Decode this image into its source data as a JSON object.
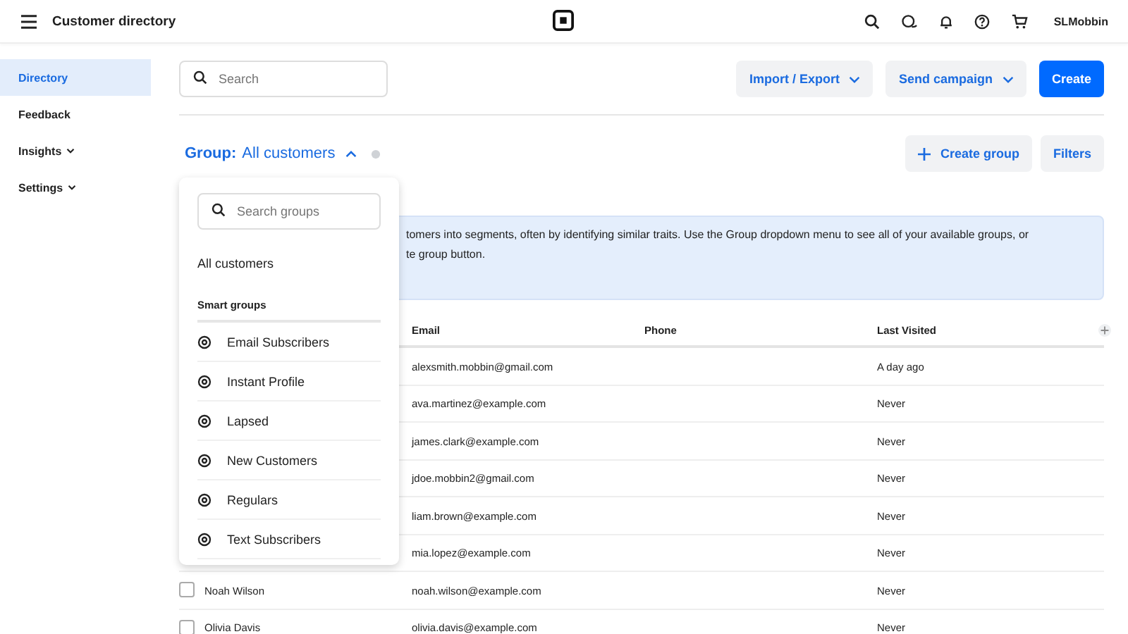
{
  "topbar": {
    "title": "Customer directory",
    "user": "SLMobbin"
  },
  "sidebar": {
    "items": [
      {
        "label": "Directory",
        "selected": true,
        "expandable": false
      },
      {
        "label": "Feedback",
        "selected": false,
        "expandable": false
      },
      {
        "label": "Insights",
        "selected": false,
        "expandable": true
      },
      {
        "label": "Settings",
        "selected": false,
        "expandable": true
      }
    ]
  },
  "search": {
    "placeholder": "Search"
  },
  "actions": [
    {
      "label": "Import / Export",
      "kind": "menu"
    },
    {
      "label": "Send campaign",
      "kind": "menu"
    },
    {
      "label": "Create",
      "kind": "primary"
    }
  ],
  "group": {
    "label": "Group:",
    "value": "All customers",
    "expanded": true
  },
  "group_actions": [
    {
      "label": "Create group",
      "kind": "add"
    },
    {
      "label": "Filters",
      "kind": "plain"
    }
  ],
  "banner": {
    "lines": [
      "tomers into segments, often by identifying similar traits. Use the Group dropdown menu to see all of your available groups, or",
      "te group button."
    ]
  },
  "table": {
    "columns": [
      "Email",
      "Phone",
      "Last Visited"
    ],
    "rows": [
      {
        "email": "alexsmith.mobbin@gmail.com",
        "last_visited": "A day ago"
      },
      {
        "email": "ava.martinez@example.com",
        "last_visited": "Never"
      },
      {
        "email": "james.clark@example.com",
        "last_visited": "Never"
      },
      {
        "email": "jdoe.mobbin2@gmail.com",
        "last_visited": "Never"
      },
      {
        "email": "liam.brown@example.com",
        "last_visited": "Never"
      },
      {
        "email": "mia.lopez@example.com",
        "last_visited": "Never"
      },
      {
        "name": "Noah Wilson",
        "email": "noah.wilson@example.com",
        "last_visited": "Never",
        "checked": false
      },
      {
        "name": "Olivia Davis",
        "email": "olivia.davis@example.com",
        "last_visited": "Never",
        "checked": false
      }
    ]
  },
  "group_menu": {
    "search_placeholder": "Search groups",
    "top_item": "All customers",
    "section": "Smart groups",
    "items": [
      "Email Subscribers",
      "Instant Profile",
      "Lapsed",
      "New Customers",
      "Regulars",
      "Text Subscribers"
    ]
  }
}
